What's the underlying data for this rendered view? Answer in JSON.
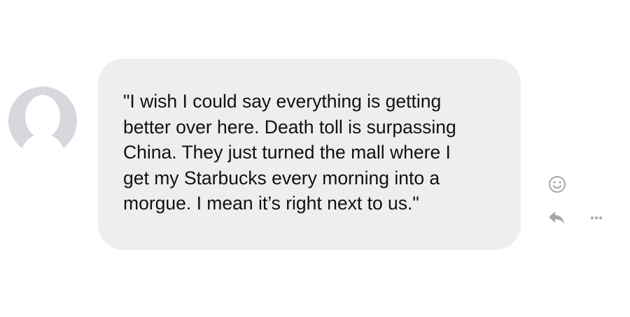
{
  "message": {
    "text": "\"I wish I could say everything is getting\nbetter over here. Death toll is surpassing\nChina. They just turned the mall where I\nget my Starbucks every morning into a\nmorgue. I mean it’s right next to us.\""
  },
  "icons": {
    "avatar": "default-profile-avatar",
    "react": "smiley-face-icon",
    "reply": "reply-arrow-icon",
    "more": "more-dots-icon"
  },
  "colors": {
    "bubble_background": "#eeeeee",
    "avatar_background": "#d6d8de",
    "icon_gray": "#a3a6ab"
  }
}
